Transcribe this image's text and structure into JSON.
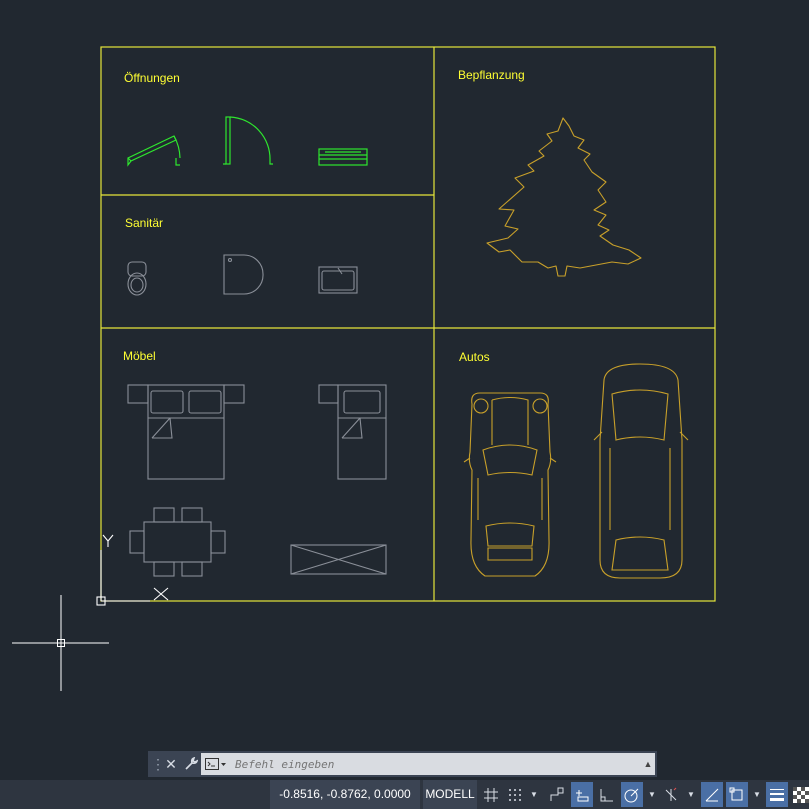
{
  "labels": {
    "openings": "Öffnungen",
    "sanitary": "Sanitär",
    "furniture": "Möbel",
    "planting": "Bepflanzung",
    "cars": "Autos"
  },
  "ucs": {
    "y_label": "Y",
    "x_label": "X"
  },
  "colors": {
    "frame": "#e5e53a",
    "label": "#ffff33",
    "green": "#2ee62e",
    "gray": "#8a8f98",
    "gold": "#c8a02a",
    "background": "#212830"
  },
  "command_line": {
    "placeholder": "Befehl eingeben",
    "close_icon": "close-icon",
    "settings_icon": "wrench-icon"
  },
  "status_bar": {
    "coordinates": "-0.8516, -0.8762, 0.0000",
    "model": "MODELL",
    "toggles": [
      "grid-icon",
      "snap-icon",
      "infer-icon",
      "dynamic-input-icon",
      "ortho-icon",
      "polar-icon",
      "isodraft-icon",
      "object-snap-tracking-icon",
      "object-snap-icon",
      "lineweight-icon",
      "transparency-icon"
    ]
  }
}
